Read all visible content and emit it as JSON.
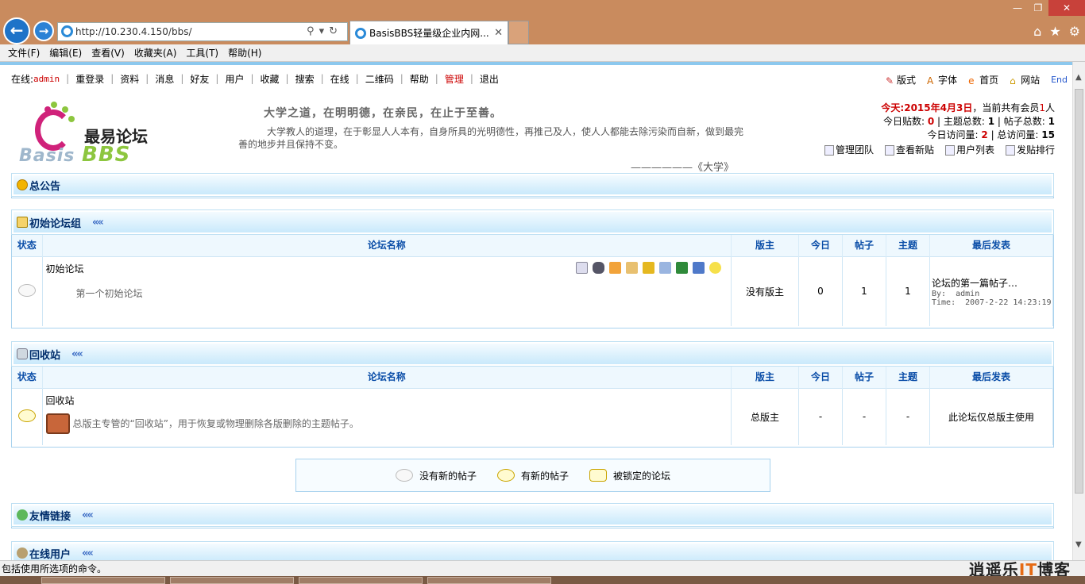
{
  "browser": {
    "url": "http://10.230.4.150/bbs/",
    "tab_title": "BasisBBS轻量级企业内网...",
    "menu": [
      "文件(F)",
      "编辑(E)",
      "查看(V)",
      "收藏夹(A)",
      "工具(T)",
      "帮助(H)"
    ]
  },
  "topnav": {
    "online_label": "在线:",
    "user": "admin",
    "links": [
      "重登录",
      "资料",
      "消息",
      "好友",
      "用户",
      "收藏",
      "搜索",
      "在线",
      "二维码",
      "帮助"
    ],
    "admin": "管理",
    "logout": "退出"
  },
  "rightnav": {
    "style": "版式",
    "font": "字体",
    "home": "首页",
    "site": "网站",
    "end": "End"
  },
  "logo": {
    "cn": "最易论坛",
    "en_basis": "Basis",
    "en_bbs": "BBS"
  },
  "motto": {
    "line1": "大学之道，在明明德，在亲民，在止于至善。",
    "line2": "大学教人的道理，在于彰显人人本有，自身所具的光明德性，再推己及人，使人人都能去除污染而自新，做到最完善的地步并且保持不变。",
    "source": "——————《大学》"
  },
  "stats": {
    "today_label": "今天:",
    "today_date": "2015年4月3日",
    "members_prefix": "，当前共有会员",
    "members": "1",
    "members_suffix": "人",
    "today_posts_label": "今日贴数:",
    "today_posts": "0",
    "topics_label": "主题总数:",
    "topics": "1",
    "posts_label": "帖子总数:",
    "posts": "1",
    "today_visits_label": "今日访问量:",
    "today_visits": "2",
    "total_visits_label": "总访问量:",
    "total_visits": "15",
    "links": [
      "管理团队",
      "查看新贴",
      "用户列表",
      "发贴排行"
    ]
  },
  "announce": {
    "title": "总公告"
  },
  "groups": [
    {
      "title": "初始论坛组",
      "columns": [
        "状态",
        "论坛名称",
        "版主",
        "今日",
        "帖子",
        "主题",
        "最后发表"
      ],
      "forum": {
        "name": "初始论坛",
        "desc": "第一个初始论坛",
        "moderator": "没有版主",
        "today": "0",
        "posts": "1",
        "topics": "1",
        "last_title": "论坛的第一篇帖子…",
        "last_by_label": "By:",
        "last_by": "admin",
        "last_time_label": "Time:",
        "last_time": "2007-2-22 14:23:19"
      }
    },
    {
      "title": "回收站",
      "columns": [
        "状态",
        "论坛名称",
        "版主",
        "今日",
        "帖子",
        "主题",
        "最后发表"
      ],
      "forum": {
        "name": "回收站",
        "desc": "总版主专管的“回收站”，用于恢复或物理删除各版删除的主题帖子。",
        "moderator": "总版主",
        "today": "-",
        "posts": "-",
        "topics": "-",
        "last": "此论坛仅总版主使用"
      }
    }
  ],
  "legend": {
    "no_new": "没有新的帖子",
    "has_new": "有新的帖子",
    "locked": "被锁定的论坛"
  },
  "links_panel": {
    "title": "友情链接"
  },
  "online_panel": {
    "title": "在线用户"
  },
  "status": {
    "text": "包括使用所选项的命令。"
  },
  "watermark": {
    "prefix": "逍遥乐",
    "highlight": "IT",
    "suffix": "博客"
  },
  "colors": {
    "accent": "#0b4ea8",
    "red": "#cc0000",
    "panel_border": "#a8d2ee",
    "chrome": "#c98b5e"
  }
}
